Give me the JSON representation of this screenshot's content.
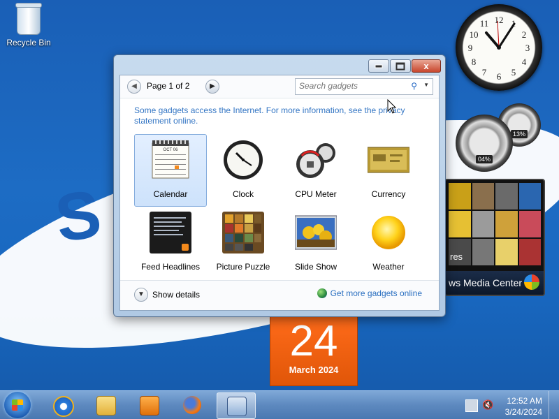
{
  "desktop": {
    "recycle_bin_label": "Recycle Bin",
    "calendar_gadget": {
      "day": "24",
      "month": "March 2024"
    },
    "cpu_gadget": {
      "cpu_pct": "04%",
      "mem_pct": "13%"
    },
    "media_gadget": {
      "partial_text_1": "res",
      "label": "ws Media Center"
    }
  },
  "window": {
    "page_label": "Page 1 of 2",
    "search": {
      "placeholder": "Search gadgets"
    },
    "notice": "Some gadgets access the Internet.  For more information, see the privacy statement online.",
    "gadgets": [
      {
        "label": "Calendar",
        "selected": true
      },
      {
        "label": "Clock"
      },
      {
        "label": "CPU Meter"
      },
      {
        "label": "Currency"
      },
      {
        "label": "Feed Headlines"
      },
      {
        "label": "Picture Puzzle"
      },
      {
        "label": "Slide Show"
      },
      {
        "label": "Weather"
      }
    ],
    "calendar_thumb_month": "OCT 06",
    "show_details": "Show details",
    "get_more": "Get more gadgets online",
    "close_glyph": "x"
  },
  "taskbar": {
    "time": "12:52 AM",
    "date": "3/24/2024",
    "items": [
      "internet-explorer",
      "file-explorer",
      "media-player",
      "firefox",
      "gadgets"
    ]
  }
}
